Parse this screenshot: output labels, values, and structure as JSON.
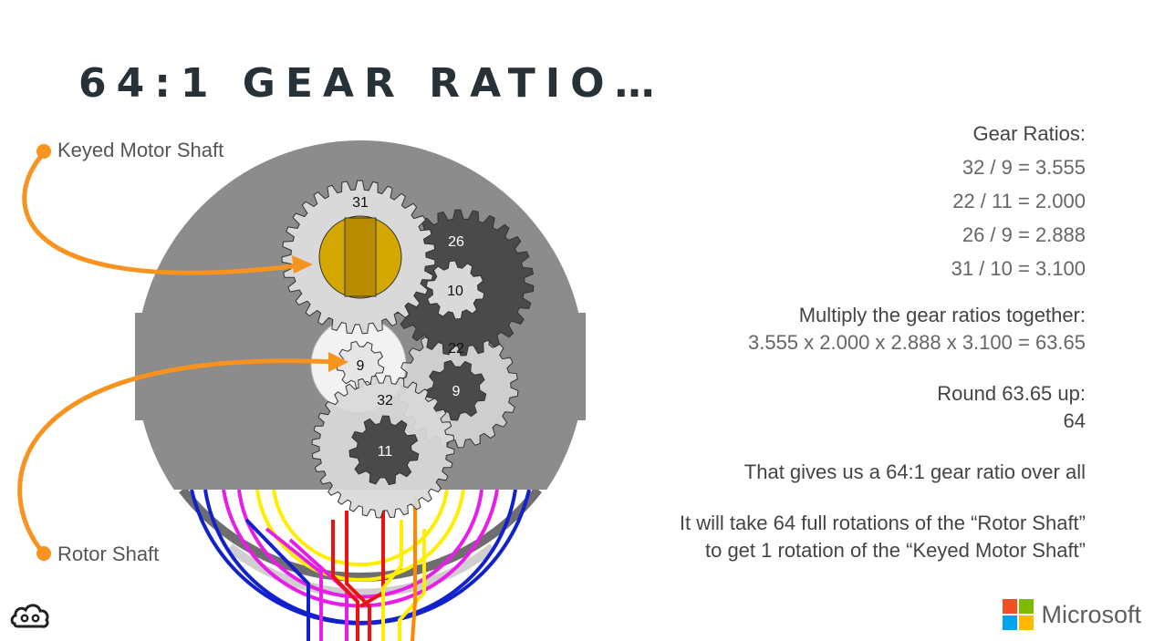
{
  "title": "64:1 GEAR RATIO…",
  "callouts": {
    "keyed_motor_shaft": "Keyed Motor Shaft",
    "rotor_shaft": "Rotor Shaft"
  },
  "gear_labels": {
    "g31": "31",
    "g26": "26",
    "g10": "10",
    "g22": "22",
    "g9_white": "9",
    "g9_dark": "9",
    "g32": "32",
    "g11": "11"
  },
  "ratios": {
    "heading": "Gear Ratios:",
    "lines": [
      "32 / 9 = 3.555",
      "22 / 11 = 2.000",
      "26 / 9 = 2.888",
      "31 / 10 = 3.100"
    ]
  },
  "multiply": {
    "heading": "Multiply the gear ratios together:",
    "equation": "3.555 x 2.000 x 2.888 x 3.100 = 63.65"
  },
  "round": {
    "heading": "Round 63.65 up:",
    "value": "64"
  },
  "summary": "That gives us a 64:1 gear ratio over all",
  "explanation": {
    "line1": "It will take 64 full rotations of the “Rotor Shaft”",
    "line2": "to get 1 rotation of the “Keyed Motor Shaft”"
  },
  "brand": {
    "name": "Microsoft",
    "colors": [
      "#f25022",
      "#7fba00",
      "#00a4ef",
      "#ffb900"
    ]
  },
  "colors": {
    "arrow": "#f7931e",
    "housing": "#8c8c8c",
    "gear_light": "#d9d9d9",
    "gear_dark": "#4a4a4a",
    "shaft": "#d4a600",
    "title": "#263238"
  }
}
